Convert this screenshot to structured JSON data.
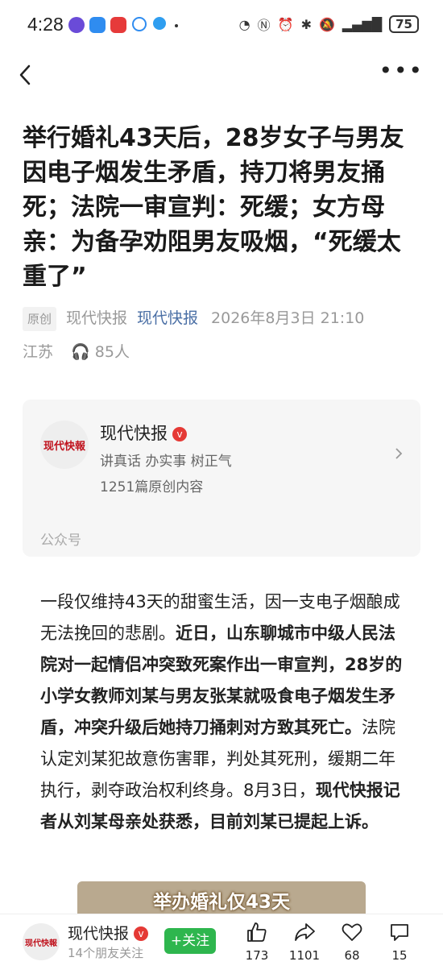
{
  "status_bar": {
    "time": "4:28",
    "battery": "75"
  },
  "article": {
    "title": "举行婚礼43天后，28岁女子与男友因电子烟发生矛盾，持刀将男友捅死；法院一审宣判：死缓；女方母亲：为备孕劝阻男友吸烟，“死缓太重了”",
    "original_badge": "原创",
    "source_plain": "现代快报",
    "source_link": "现代快报",
    "datetime": "2026年8月3日 21:10",
    "region": "江苏",
    "listeners": "85人"
  },
  "account_card": {
    "avatar_text": "现代快報",
    "name": "现代快报",
    "verified_mark": "v",
    "slogan": "讲真话 办实事 树正气",
    "count": "1251篇原创内容",
    "type": "公众号"
  },
  "body": {
    "p1": "一段仅维持43天的甜蜜生活，因一支电子烟酿成无法挽回的悲剧。",
    "p2_bold": "近日，山东聊城市中级人民法院对一起情侣冲突致死案作出一审宣判，28岁的小学女教师刘某与男友张某就吸食电子烟发生矛盾，冲突升级后她持刀捅刺对方致其死亡。",
    "p3": "法院认定刘某犯故意伤害罪，判处其死刑，缓期二年执行，剥夺政治权利终身。8月3日，",
    "p4_bold": "现代快报记者从刘某母亲处获悉，目前刘某已提起上诉。"
  },
  "image_caption": "举办婚礼仅43天",
  "bottom_bar": {
    "avatar_text": "现代快報",
    "name": "现代快报",
    "verified_mark": "v",
    "friends": "14个朋友关注",
    "follow_label": "+关注",
    "likes": "173",
    "shares": "1101",
    "hearts": "68",
    "comments": "15"
  },
  "colors": {
    "accent_green": "#2eb64e",
    "link_blue": "#4a6fa5",
    "brand_red": "#c0121d"
  }
}
